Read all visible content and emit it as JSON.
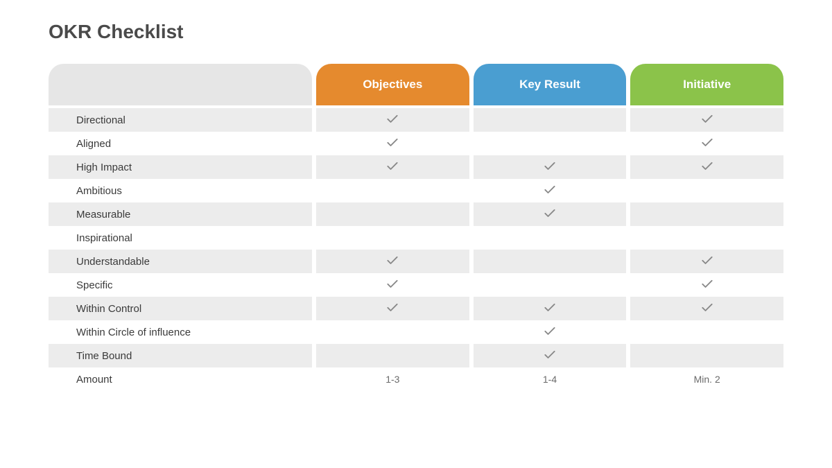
{
  "title": "OKR Checklist",
  "columns": {
    "objectives": "Objectives",
    "key_result": "Key Result",
    "initiative": "Initiative"
  },
  "rows": [
    {
      "label": "Directional",
      "objectives": "check",
      "key_result": "",
      "initiative": "check"
    },
    {
      "label": "Aligned",
      "objectives": "check",
      "key_result": "",
      "initiative": "check"
    },
    {
      "label": "High Impact",
      "objectives": "check",
      "key_result": "check",
      "initiative": "check"
    },
    {
      "label": "Ambitious",
      "objectives": "",
      "key_result": "check",
      "initiative": ""
    },
    {
      "label": "Measurable",
      "objectives": "",
      "key_result": "check",
      "initiative": ""
    },
    {
      "label": "Inspirational",
      "objectives": "",
      "key_result": "",
      "initiative": ""
    },
    {
      "label": "Understandable",
      "objectives": "check",
      "key_result": "",
      "initiative": "check"
    },
    {
      "label": "Specific",
      "objectives": "check",
      "key_result": "",
      "initiative": "check"
    },
    {
      "label": "Within Control",
      "objectives": "check",
      "key_result": "check",
      "initiative": "check"
    },
    {
      "label": "Within Circle of influence",
      "objectives": "",
      "key_result": "check",
      "initiative": ""
    },
    {
      "label": "Time Bound",
      "objectives": "",
      "key_result": "check",
      "initiative": ""
    },
    {
      "label": "Amount",
      "objectives": "1-3",
      "key_result": "1-4",
      "initiative": "Min. 2"
    }
  ]
}
